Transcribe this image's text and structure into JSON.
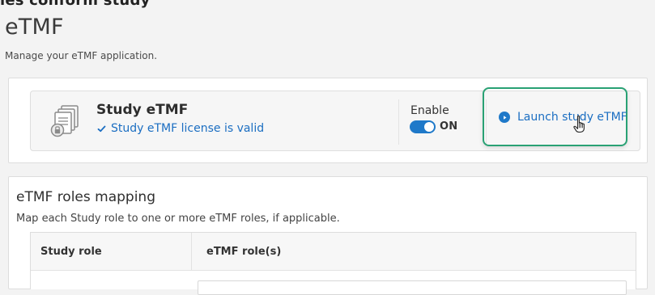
{
  "header": {
    "top_crop": "ies conform study",
    "title": "eTMF",
    "subtitle": "Manage your eTMF application."
  },
  "study_card": {
    "title": "Study eTMF",
    "license_text": "Study eTMF license is valid",
    "license_icon": "check-icon",
    "enable_label": "Enable",
    "toggle_state": "ON",
    "launch_label": "Launch study eTMF",
    "launch_icon": "play-icon",
    "cursor_icon": "hand-pointer-icon",
    "highlight_color": "#29a174",
    "accent_color": "#1f79c9"
  },
  "roles_mapping": {
    "title": "eTMF roles mapping",
    "description": "Map each Study role to one or more eTMF roles, if applicable.",
    "columns": [
      "Study role",
      "eTMF role(s)"
    ]
  }
}
